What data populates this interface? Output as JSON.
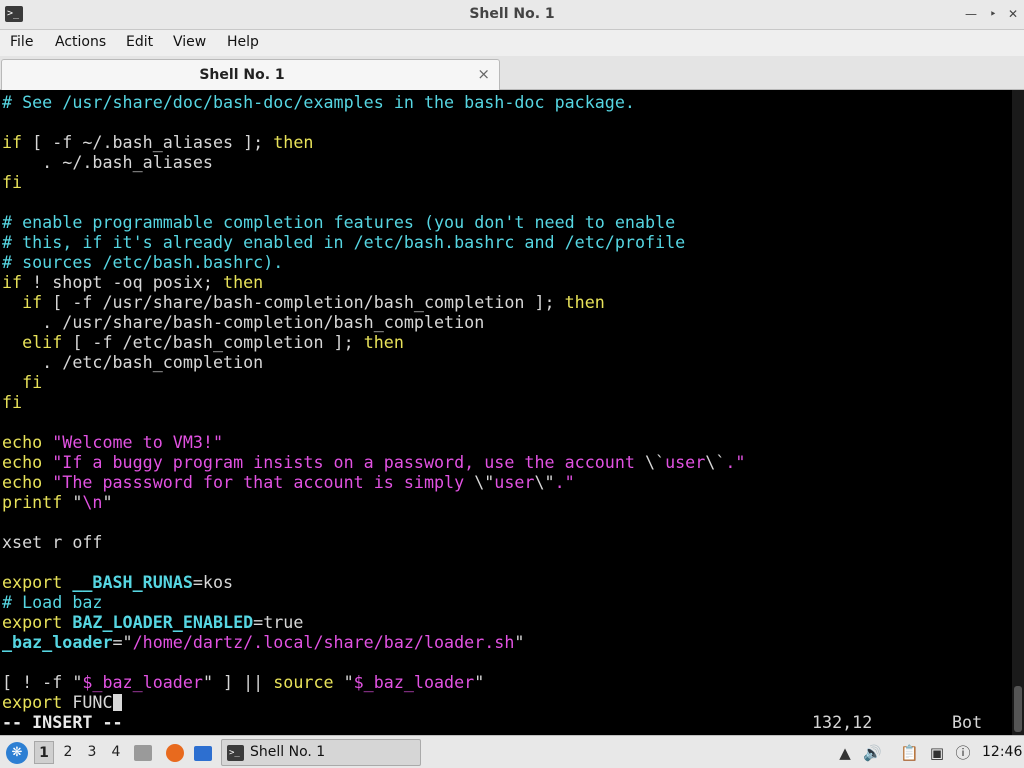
{
  "window": {
    "title": "Shell No. 1",
    "icon": "terminal-icon"
  },
  "menu": [
    "File",
    "Actions",
    "Edit",
    "View",
    "Help"
  ],
  "tab": {
    "label": "Shell No. 1",
    "close_glyph": "×"
  },
  "terminal": {
    "lines": [
      [
        [
          "# See /usr/share/doc/bash-doc/examples in the bash-doc package.",
          "c-comment"
        ]
      ],
      [],
      [
        [
          "if",
          "c-kw"
        ],
        [
          " [ -f ~/.bash_aliases ]; ",
          "c-plain"
        ],
        [
          "then",
          "c-kw"
        ]
      ],
      [
        [
          "    . ~/.bash_aliases",
          "c-plain"
        ]
      ],
      [
        [
          "fi",
          "c-kw"
        ]
      ],
      [],
      [
        [
          "# enable programmable completion features (you don't need to enable",
          "c-comment"
        ]
      ],
      [
        [
          "# this, if it's already enabled in /etc/bash.bashrc and /etc/profile",
          "c-comment"
        ]
      ],
      [
        [
          "# sources /etc/bash.bashrc).",
          "c-comment"
        ]
      ],
      [
        [
          "if",
          "c-kw"
        ],
        [
          " ! shopt -oq posix; ",
          "c-plain"
        ],
        [
          "then",
          "c-kw"
        ]
      ],
      [
        [
          "  ",
          "c-plain"
        ],
        [
          "if",
          "c-kw"
        ],
        [
          " [ -f /usr/share/bash-completion/bash_completion ]; ",
          "c-plain"
        ],
        [
          "then",
          "c-kw"
        ]
      ],
      [
        [
          "    . /usr/share/bash-completion/bash_completion",
          "c-plain"
        ]
      ],
      [
        [
          "  ",
          "c-plain"
        ],
        [
          "elif",
          "c-kw"
        ],
        [
          " [ -f /etc/bash_completion ]; ",
          "c-plain"
        ],
        [
          "then",
          "c-kw"
        ]
      ],
      [
        [
          "    . /etc/bash_completion",
          "c-plain"
        ]
      ],
      [
        [
          "  ",
          "c-plain"
        ],
        [
          "fi",
          "c-kw"
        ]
      ],
      [
        [
          "fi",
          "c-kw"
        ]
      ],
      [],
      [
        [
          "echo",
          "c-kw"
        ],
        [
          " ",
          "c-plain"
        ],
        [
          "\"Welcome to VM3!\"",
          "c-str"
        ]
      ],
      [
        [
          "echo",
          "c-kw"
        ],
        [
          " ",
          "c-plain"
        ],
        [
          "\"If a buggy program insists on a password, use the account ",
          "c-str"
        ],
        [
          "\\`",
          "c-plain"
        ],
        [
          "user",
          "c-str"
        ],
        [
          "\\`",
          "c-plain"
        ],
        [
          ".\"",
          "c-str"
        ]
      ],
      [
        [
          "echo",
          "c-kw"
        ],
        [
          " ",
          "c-plain"
        ],
        [
          "\"The passsword for that account is simply ",
          "c-str"
        ],
        [
          "\\\"",
          "c-plain"
        ],
        [
          "user",
          "c-str"
        ],
        [
          "\\\"",
          "c-plain"
        ],
        [
          ".\"",
          "c-str"
        ]
      ],
      [
        [
          "printf",
          "c-kw"
        ],
        [
          " \"",
          "c-plain"
        ],
        [
          "\\n",
          "c-str"
        ],
        [
          "\"",
          "c-plain"
        ]
      ],
      [],
      [
        [
          "xset r off",
          "c-plain"
        ]
      ],
      [],
      [
        [
          "export",
          "c-kw"
        ],
        [
          " ",
          "c-plain"
        ],
        [
          "__BASH_RUNAS",
          "c-var"
        ],
        [
          "=kos",
          "c-plain"
        ]
      ],
      [
        [
          "# Load baz",
          "c-comment"
        ]
      ],
      [
        [
          "export",
          "c-kw"
        ],
        [
          " ",
          "c-plain"
        ],
        [
          "BAZ_LOADER_ENABLED",
          "c-var"
        ],
        [
          "=true",
          "c-plain"
        ]
      ],
      [
        [
          "_baz_loader",
          "c-var"
        ],
        [
          "=\"",
          "c-plain"
        ],
        [
          "/home/dartz/.local/share/baz/loader.sh",
          "c-str"
        ],
        [
          "\"",
          "c-plain"
        ]
      ],
      [],
      [
        [
          "[ ! -f \"",
          "c-plain"
        ],
        [
          "$_baz_loader",
          "c-str"
        ],
        [
          "\" ] || ",
          "c-plain"
        ],
        [
          "source",
          "c-kw"
        ],
        [
          " \"",
          "c-plain"
        ],
        [
          "$_baz_loader",
          "c-str"
        ],
        [
          "\"",
          "c-plain"
        ]
      ],
      [
        [
          "export",
          "c-kw"
        ],
        [
          " FUNC",
          "c-plain"
        ]
      ]
    ],
    "status_mode": "-- INSERT --",
    "status_position": "132,12",
    "status_scroll": "Bot"
  },
  "taskbar": {
    "workspaces": [
      "1",
      "2",
      "3",
      "4"
    ],
    "active_workspace": "1",
    "task_label": "Shell No. 1",
    "clock": "12:46"
  }
}
